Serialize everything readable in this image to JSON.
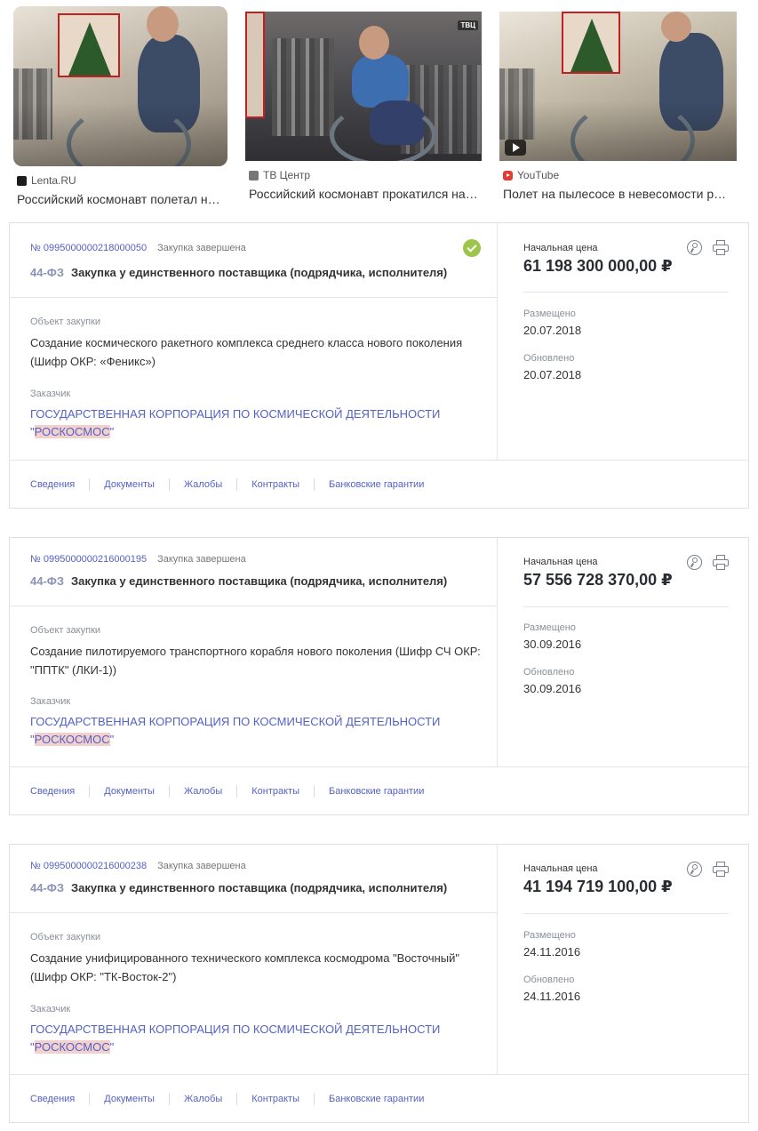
{
  "videos": [
    {
      "source": "Lenta.RU",
      "source_icon": "lenta-icon",
      "title": "Российский космонавт полетал на пылесосе в невесомости",
      "has_play": false
    },
    {
      "source": "ТВ Центр",
      "source_icon": "tvc-icon",
      "title": "Российский космонавт прокатился на пылесосе",
      "has_play": false,
      "thumb_logo": "ТВЦ"
    },
    {
      "source": "YouTube",
      "source_icon": "youtube-icon",
      "title": "Полет на пылесосе в невесомости российского космонавта",
      "has_play": true
    }
  ],
  "cards": [
    {
      "reg_number": "№ 0995000000218000050",
      "status": "Закупка завершена",
      "law": "44-ФЗ",
      "procurement_type": "Закупка у единственного поставщика (подрядчика, исполнителя)",
      "verified": true,
      "object_label": "Объект закупки",
      "object": "Создание космического ракетного комплекса среднего класса нового поколения (Шифр ОКР: «Феникс»)",
      "customer_label": "Заказчик",
      "customer_name": "ГОСУДАРСТВЕННАЯ КОРПОРАЦИЯ ПО КОСМИЧЕСКОЙ ДЕЯТЕЛЬНОСТИ",
      "customer_q1": "\"",
      "customer_hl": "РОСКОСМОС",
      "customer_q2": "\"",
      "price_label": "Начальная цена",
      "price": "61 198 300 000,00 ₽",
      "placed_label": "Размещено",
      "placed": "20.07.2018",
      "updated_label": "Обновлено",
      "updated": "20.07.2018",
      "tabs": [
        "Сведения",
        "Документы",
        "Жалобы",
        "Контракты",
        "Банковские гарантии"
      ]
    },
    {
      "reg_number": "№ 0995000000216000195",
      "status": "Закупка завершена",
      "law": "44-ФЗ",
      "procurement_type": "Закупка у единственного поставщика (подрядчика, исполнителя)",
      "verified": false,
      "object_label": "Объект закупки",
      "object": "Создание пилотируемого транспортного корабля нового поколения (Шифр СЧ ОКР: \"ППТК\" (ЛКИ-1))",
      "customer_label": "Заказчик",
      "customer_name": "ГОСУДАРСТВЕННАЯ КОРПОРАЦИЯ ПО КОСМИЧЕСКОЙ ДЕЯТЕЛЬНОСТИ",
      "customer_q1": "\"",
      "customer_hl": "РОСКОСМОС",
      "customer_q2": "\"",
      "price_label": "Начальная цена",
      "price": "57 556 728 370,00 ₽",
      "placed_label": "Размещено",
      "placed": "30.09.2016",
      "updated_label": "Обновлено",
      "updated": "30.09.2016",
      "tabs": [
        "Сведения",
        "Документы",
        "Жалобы",
        "Контракты",
        "Банковские гарантии"
      ]
    },
    {
      "reg_number": "№ 0995000000216000238",
      "status": "Закупка завершена",
      "law": "44-ФЗ",
      "procurement_type": "Закупка у единственного поставщика (подрядчика, исполнителя)",
      "verified": false,
      "object_label": "Объект закупки",
      "object": "Создание унифицированного технического комплекса космодрома \"Восточный\" (Шифр ОКР: \"ТК-Восток-2\")",
      "customer_label": "Заказчик",
      "customer_name": "ГОСУДАРСТВЕННАЯ КОРПОРАЦИЯ ПО КОСМИЧЕСКОЙ ДЕЯТЕЛЬНОСТИ",
      "customer_q1": "\"",
      "customer_hl": "РОСКОСМОС",
      "customer_q2": "\"",
      "price_label": "Начальная цена",
      "price": "41 194 719 100,00 ₽",
      "placed_label": "Размещено",
      "placed": "24.11.2016",
      "updated_label": "Обновлено",
      "updated": "24.11.2016",
      "tabs": [
        "Сведения",
        "Документы",
        "Жалобы",
        "Контракты",
        "Банковские гарантии"
      ]
    }
  ],
  "colors": {
    "link": "#5461c6",
    "highlight": "#f2d0cd",
    "success": "#9dc54a"
  }
}
